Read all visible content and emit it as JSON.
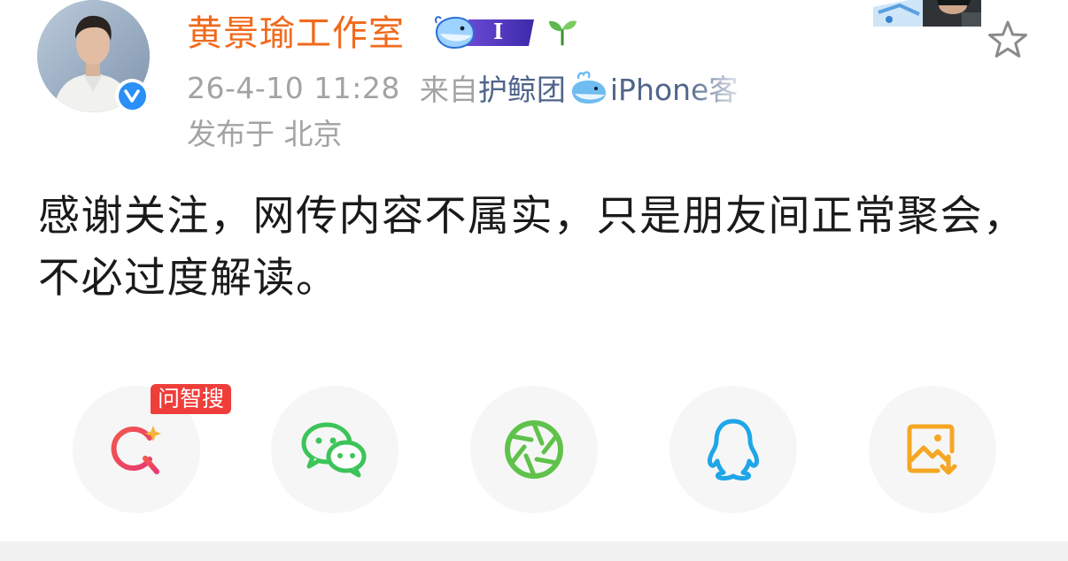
{
  "post": {
    "author": "黄景瑜工作室",
    "vip_level": "I",
    "time": "26-4-10 11:28",
    "from_prefix": "来自",
    "source": "护鲸团",
    "client": "iPhone客",
    "location": "发布于 北京",
    "content": "感谢关注，网传内容不属实，只是朋友间正常聚会，不必过度解读。"
  },
  "icons": {
    "verify": "verified-check-icon",
    "vip": "whale-vip-badge-icon",
    "sprout": "sprout-icon",
    "favorite": "star-outline-icon"
  },
  "share": {
    "ai_search_tag": "问智搜",
    "items": [
      {
        "name": "ai-search",
        "icon": "magnifier-sparkle-icon"
      },
      {
        "name": "wechat",
        "icon": "wechat-icon"
      },
      {
        "name": "moments",
        "icon": "camera-shutter-icon"
      },
      {
        "name": "qq",
        "icon": "qq-penguin-icon"
      },
      {
        "name": "save-image",
        "icon": "image-download-icon"
      }
    ]
  },
  "colors": {
    "author": "#f06a1c",
    "meta": "#a3a3a3",
    "source_link": "#50658a",
    "verify": "#2a8ff7",
    "wechat": "#3cc45a",
    "qq": "#1ea6e8",
    "save": "#f5a623",
    "tag": "#ef3e3a"
  }
}
